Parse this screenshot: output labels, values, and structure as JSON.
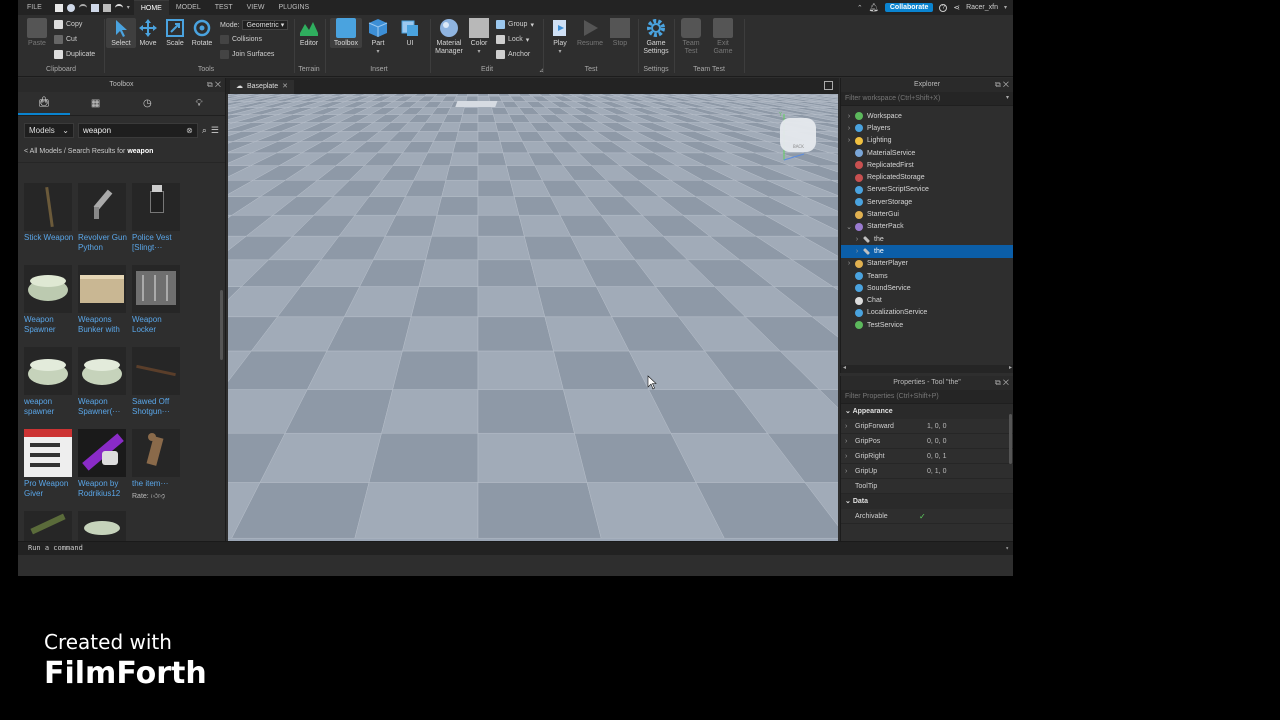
{
  "menubar": {
    "tabs": [
      "FILE",
      "HOME",
      "MODEL",
      "TEST",
      "VIEW",
      "PLUGINS"
    ],
    "active_tab": "HOME",
    "collaborate_label": "Collaborate",
    "username": "Racer_xfn"
  },
  "ribbon": {
    "clipboard": {
      "paste": "Paste",
      "copy": "Copy",
      "cut": "Cut",
      "duplicate": "Duplicate",
      "label": "Clipboard"
    },
    "tools": {
      "select": "Select",
      "move": "Move",
      "scale": "Scale",
      "rotate": "Rotate",
      "mode_label": "Mode:",
      "mode_value": "Geometric",
      "collisions": "Collisions",
      "join_surfaces": "Join Surfaces",
      "label": "Tools"
    },
    "terrain": {
      "editor": "Editor",
      "label": "Terrain"
    },
    "insert": {
      "toolbox": "Toolbox",
      "part": "Part",
      "ui": "UI",
      "label": "Insert"
    },
    "edit": {
      "material": "Material Manager",
      "color": "Color",
      "group": "Group",
      "lock": "Lock",
      "anchor": "Anchor",
      "label": "Edit"
    },
    "test": {
      "play": "Play",
      "resume": "Resume",
      "stop": "Stop",
      "label": "Test"
    },
    "settings": {
      "game_settings": "Game Settings",
      "label": "Settings"
    },
    "team_test": {
      "team_test": "Team Test",
      "exit_game": "Exit Game",
      "label": "Team Test"
    }
  },
  "toolbox": {
    "title": "Toolbox",
    "category": "Models",
    "search_value": "weapon",
    "breadcrumb_prefix": "< All Models / Search Results for",
    "breadcrumb_term": "weapon",
    "items": [
      {
        "name": "Stick Weapon"
      },
      {
        "name": "Revolver Gun Python"
      },
      {
        "name": "Police Vest [Slingt···"
      },
      {
        "name": "Weapon Spawner"
      },
      {
        "name": "Weapons Bunker with"
      },
      {
        "name": "Weapon Locker"
      },
      {
        "name": "weapon spawner"
      },
      {
        "name": "Weapon Spawner(···"
      },
      {
        "name": "Sawed Off Shotgun···"
      },
      {
        "name": "Pro Weapon Giver"
      },
      {
        "name": "Weapon by Rodrikius12"
      },
      {
        "name": "the item···"
      }
    ],
    "rate_label": "Rate:"
  },
  "viewport": {
    "tab_label": "Baseplate"
  },
  "explorer": {
    "title": "Explorer",
    "filter_placeholder": "Filter workspace (Ctrl+Shift+X)",
    "items": [
      {
        "label": "Workspace",
        "color": "#5cb85c"
      },
      {
        "label": "Players",
        "color": "#4aa3df"
      },
      {
        "label": "Lighting",
        "color": "#f0c040"
      },
      {
        "label": "MaterialService",
        "color": "#7aa6d8"
      },
      {
        "label": "ReplicatedFirst",
        "color": "#c85050"
      },
      {
        "label": "ReplicatedStorage",
        "color": "#c85050"
      },
      {
        "label": "ServerScriptService",
        "color": "#4aa3df"
      },
      {
        "label": "ServerStorage",
        "color": "#4aa3df"
      },
      {
        "label": "StarterGui",
        "color": "#e0b050"
      },
      {
        "label": "StarterPack",
        "color": "#9a7bd0"
      },
      {
        "label": "the",
        "color": "#c0c0c0"
      },
      {
        "label": "the",
        "color": "#c0c0c0"
      },
      {
        "label": "StarterPlayer",
        "color": "#e0b050"
      },
      {
        "label": "Teams",
        "color": "#4aa3df"
      },
      {
        "label": "SoundService",
        "color": "#4aa3df"
      },
      {
        "label": "Chat",
        "color": "#dddddd"
      },
      {
        "label": "LocalizationService",
        "color": "#4aa3df"
      },
      {
        "label": "TestService",
        "color": "#5cb85c"
      }
    ]
  },
  "properties": {
    "title": "Properties - Tool \"the\"",
    "filter_placeholder": "Filter Properties (Ctrl+Shift+P)",
    "appearance_label": "Appearance",
    "rows": [
      {
        "name": "GripForward",
        "value": "1, 0, 0"
      },
      {
        "name": "GripPos",
        "value": "0, 0, 0"
      },
      {
        "name": "GripRight",
        "value": "0, 0, 1"
      },
      {
        "name": "GripUp",
        "value": "0, 1, 0"
      },
      {
        "name": "ToolTip",
        "value": ""
      }
    ],
    "data_label": "Data",
    "archivable_label": "Archivable"
  },
  "command_bar": {
    "placeholder": "Run a command"
  },
  "watermark": {
    "line1": "Created with",
    "line2": "FilmForth"
  }
}
